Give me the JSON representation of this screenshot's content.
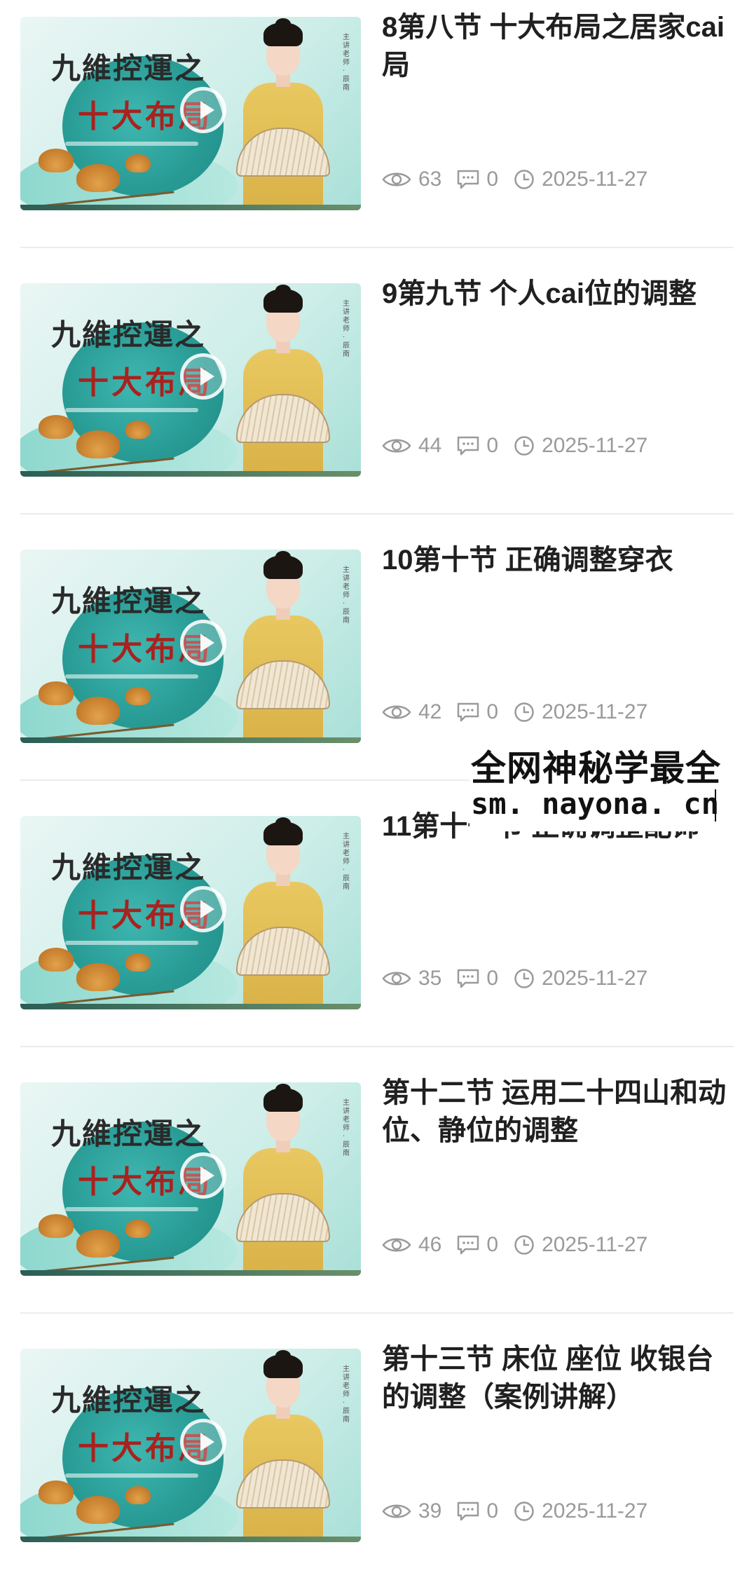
{
  "thumbnail": {
    "title_line1": "九維控運之",
    "title_line2": "十大布局",
    "vertical_caption": "主讲老师·辰南"
  },
  "items": [
    {
      "title": "8第八节 十大布局之居家cai局",
      "views": "63",
      "comments": "0",
      "date": "2025-11-27"
    },
    {
      "title": "9第九节 个人cai位的调整",
      "views": "44",
      "comments": "0",
      "date": "2025-11-27"
    },
    {
      "title": "10第十节 正确调整穿衣",
      "views": "42",
      "comments": "0",
      "date": "2025-11-27"
    },
    {
      "title": "11第十一节 正确调整配饰",
      "views": "35",
      "comments": "0",
      "date": "2025-11-27"
    },
    {
      "title": "第十二节 运用二十四山和动位、静位的调整",
      "views": "46",
      "comments": "0",
      "date": "2025-11-27"
    },
    {
      "title": "第十三节 床位 座位 收银台的调整（案例讲解）",
      "views": "39",
      "comments": "0",
      "date": "2025-11-27"
    }
  ],
  "watermark": {
    "line1": "全网神秘学最全",
    "line2": "sm. nayona. cn"
  },
  "colors": {
    "title_text": "#202020",
    "meta_text": "#9a9a9a",
    "divider": "#ececec",
    "thumb_accent_red": "#a8221f",
    "thumb_teal": "#2a9d97"
  }
}
